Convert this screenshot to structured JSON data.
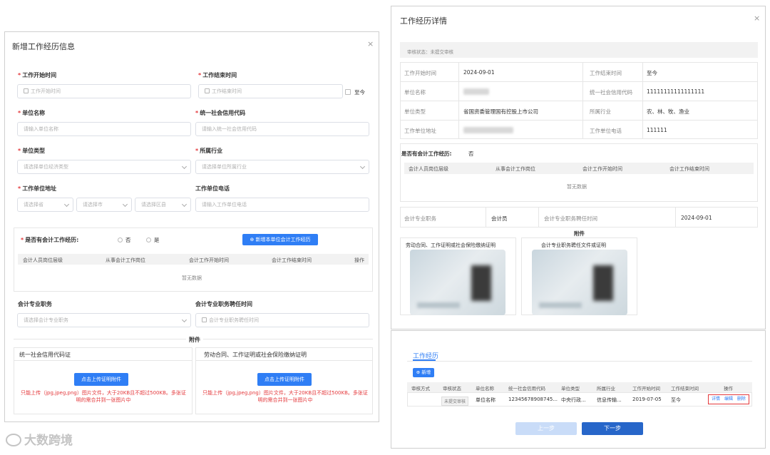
{
  "left_dialog": {
    "title": "新增工作经历信息",
    "close": "×",
    "start_time": {
      "label": "工作开始时间",
      "placeholder": "工作开始时间"
    },
    "end_time": {
      "label": "工作结束时间",
      "placeholder": "工作结束时间",
      "until_now": "至今"
    },
    "unit_name": {
      "label": "单位名称",
      "placeholder": "请输入单位名称"
    },
    "credit_code": {
      "label": "统一社会信用代码",
      "placeholder": "请输入统一社会信用代码"
    },
    "unit_type": {
      "label": "单位类型",
      "placeholder": "请选择单位经济类型"
    },
    "industry": {
      "label": "所属行业",
      "placeholder": "请选择单位所属行业"
    },
    "address": {
      "label": "工作单位地址",
      "province": "请选择省",
      "city": "请选择市",
      "district": "请选择区县"
    },
    "phone": {
      "label": "工作单位电话",
      "placeholder": "请输入工作单位电话"
    },
    "accounting": {
      "question": "是否有会计工作经历:",
      "no": "否",
      "yes": "是",
      "add_button": "新增本单位会计工作经历",
      "columns": [
        "会计人员岗位层级",
        "从事会计工作岗位",
        "会计工作开始时间",
        "会计工作结束时间",
        "操作"
      ],
      "empty": "暂无数据"
    },
    "position": {
      "label": "会计专业职务",
      "placeholder": "请选择会计专业职务"
    },
    "position_time": {
      "label": "会计专业职务聘任时间",
      "placeholder": "会计专业职务聘任时间"
    },
    "attachments_title": "附件",
    "attach_left": {
      "title": "统一社会信用代码证",
      "button": "点击上传证明附件",
      "note": "只能上传（jpg,jpeg,png）图片文件，大于20KB且不超过500KB。多张证明的需合并到一张图片中"
    },
    "attach_right": {
      "title": "劳动合同、工作证明或社会保险缴纳证明",
      "button": "点击上传证明附件",
      "note": "只能上传（jpg,jpeg,png）图片文件，大于20KB且不超过500KB。多张证明的需合并到一张图片中"
    }
  },
  "right_dialog": {
    "title": "工作经历详情",
    "close": "×",
    "status": "审核状态：未提交审核",
    "rows": [
      {
        "l1": "工作开始时间",
        "v1": "2024-09-01",
        "l2": "工作结束时间",
        "v2": "至今"
      },
      {
        "l1": "单位名称",
        "v1": "",
        "l2": "统一社会信用代码",
        "v2": "11111111111111111"
      },
      {
        "l1": "单位类型",
        "v1": "省国资委管理国有控股上市公司",
        "l2": "所属行业",
        "v2": "农、林、牧、渔业"
      },
      {
        "l1": "工作单位地址",
        "v1": "",
        "l2": "工作单位电话",
        "v2": "111111"
      }
    ],
    "accounting_question": "是否有会计工作经历:",
    "accounting_answer": "否",
    "columns": [
      "会计人员岗位层级",
      "从事会计工作岗位",
      "会计工作开始时间",
      "会计工作结束时间"
    ],
    "empty": "暂无数据",
    "position_label": "会计专业职务",
    "position_value": "会计员",
    "position_time_label": "会计专业职务聘任时间",
    "position_time_value": "2024-09-01",
    "attachments_title": "附件",
    "attach1_title": "劳动合同、工作证明或社会保险缴纳证明",
    "attach2_title": "会计专业职务聘任文件或证明"
  },
  "list_panel": {
    "tab": "工作经历",
    "add_button": "新增",
    "columns": [
      "审核方式",
      "审核状态",
      "单位名称",
      "统一社会信用代码",
      "单位类型",
      "所属行业",
      "工作开始时间",
      "工作结束时间",
      "操作"
    ],
    "row": {
      "status": "未提交审核",
      "unit_name": "单位名称",
      "credit_code": "12345678908745...",
      "unit_type": "中央行政...",
      "industry": "信息传输...",
      "start": "2019-07-05",
      "end": "至今",
      "op_detail": "详情",
      "op_edit": "编辑",
      "op_delete": "删除"
    },
    "prev_button": "上一步",
    "next_button": "下一步"
  },
  "watermark": "大数跨境",
  "colors": {
    "primary": "#2f7ef5",
    "required": "#e4393c",
    "border": "#dcdfe6"
  }
}
